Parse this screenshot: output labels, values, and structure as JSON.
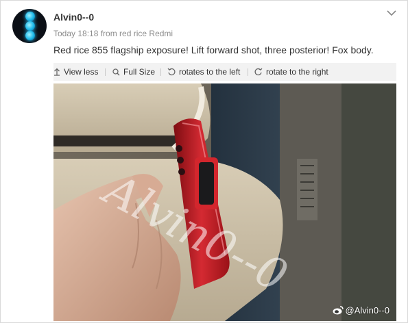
{
  "post": {
    "author": "Alvin0--0",
    "meta": "Today 18:18 from red rice Redmi",
    "text": "Red rice 855 flagship exposure! Lift forward shot, three posterior! Fox body."
  },
  "toolbar": {
    "view_less": "View less",
    "full_size": "Full Size",
    "rotate_left": "rotates to the left",
    "rotate_right": "rotate to the right"
  },
  "photo": {
    "watermark_handwritten": "Alvin0--0",
    "watermark_handle": "@Alvin0--0"
  },
  "icons": {
    "menu": "chevron-down-icon",
    "view_less": "arrow-up-icon",
    "full_size": "magnifier-icon",
    "rotate_left": "rotate-left-icon",
    "rotate_right": "rotate-right-icon",
    "watermark": "weibo-logo-icon"
  },
  "colors": {
    "toolbar_bg": "#f2f2f2",
    "meta_text": "#8c8c8c",
    "phone_red": "#c8202a",
    "avatar_glow": "#1ab7e8"
  }
}
